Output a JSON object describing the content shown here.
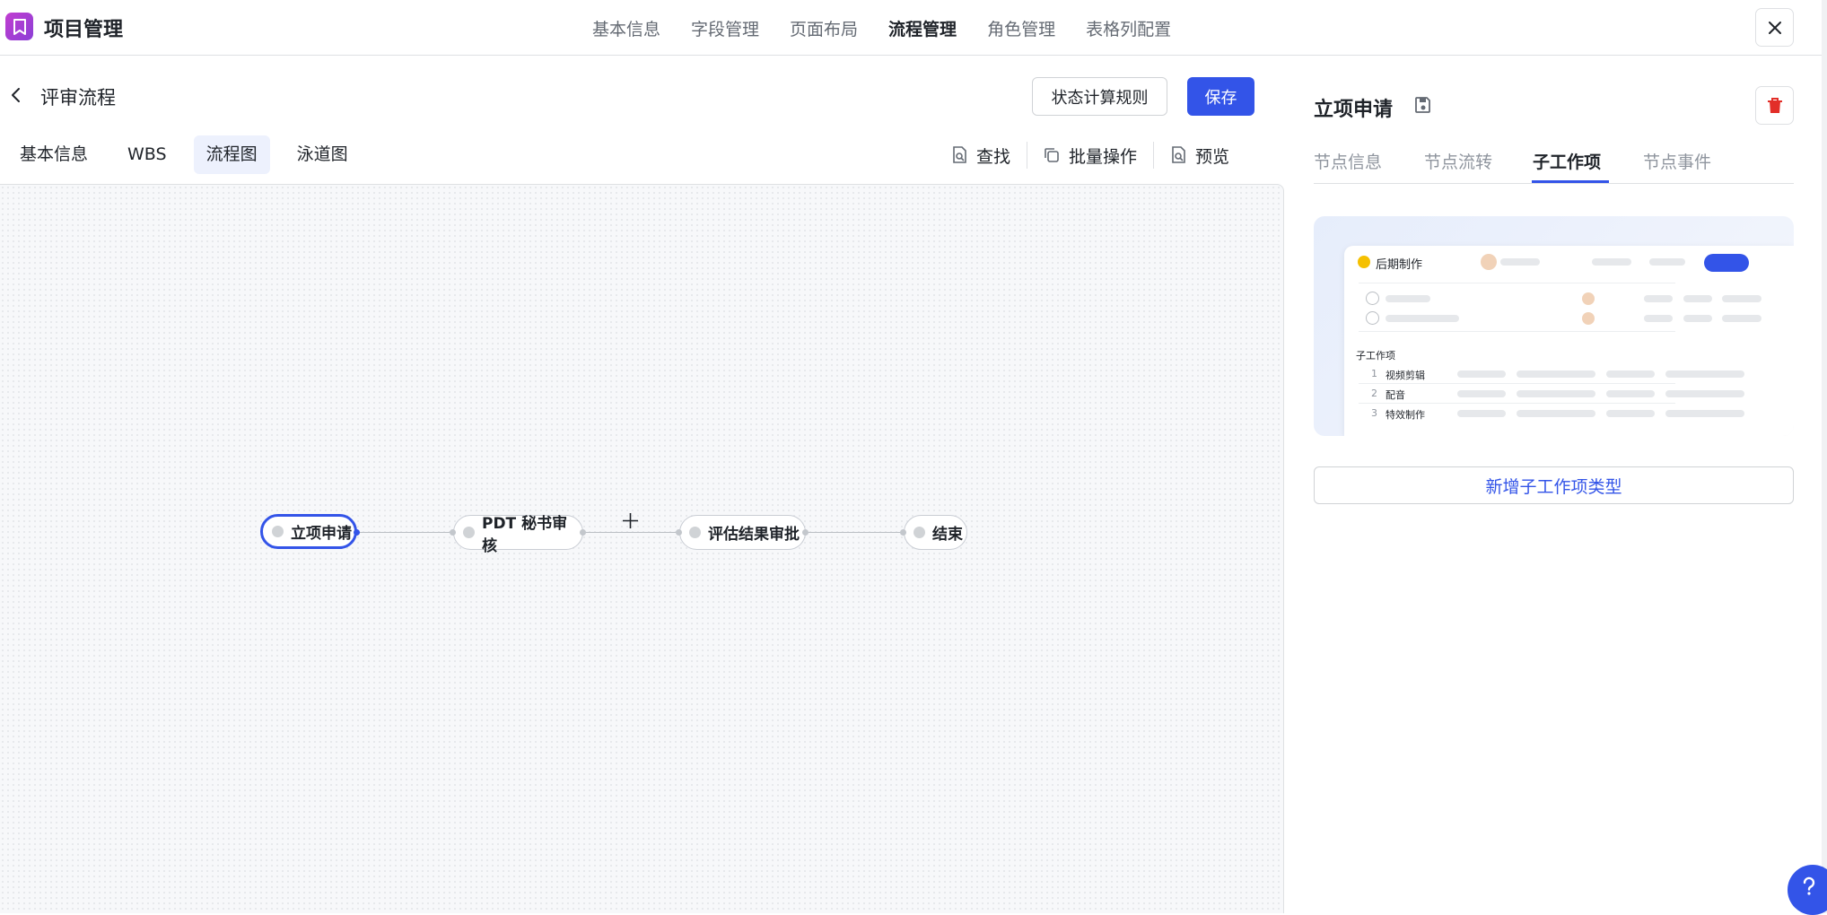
{
  "app": {
    "title": "项目管理"
  },
  "topnav": [
    "基本信息",
    "字段管理",
    "页面布局",
    "流程管理",
    "角色管理",
    "表格列配置"
  ],
  "topnav_active": "流程管理",
  "page": {
    "title": "评审流程",
    "rule_button": "状态计算规则",
    "save_button": "保存"
  },
  "subtabs": [
    "基本信息",
    "WBS",
    "流程图",
    "泳道图"
  ],
  "subtabs_active": "流程图",
  "tools": {
    "find": "查找",
    "batch": "批量操作",
    "preview": "预览"
  },
  "flow_nodes": [
    {
      "label": "立项申请",
      "selected": true
    },
    {
      "label": "PDT 秘书审核",
      "selected": false
    },
    {
      "label": "评估结果审批",
      "selected": false
    },
    {
      "label": "结束",
      "selected": false
    }
  ],
  "right_panel": {
    "title": "立项申请",
    "tabs": [
      "节点信息",
      "节点流转",
      "子工作项",
      "节点事件"
    ],
    "active_tab": "子工作项",
    "preview": {
      "card_title": "后期制作",
      "section_label": "子工作项",
      "rows": [
        {
          "num": "1",
          "name": "视频剪辑"
        },
        {
          "num": "2",
          "name": "配音"
        },
        {
          "num": "3",
          "name": "特效制作"
        }
      ]
    },
    "add_button": "新增子工作项类型"
  },
  "colors": {
    "accent": "#3354e8",
    "delete": "#e22e28",
    "status_dot": "#f5c000"
  }
}
